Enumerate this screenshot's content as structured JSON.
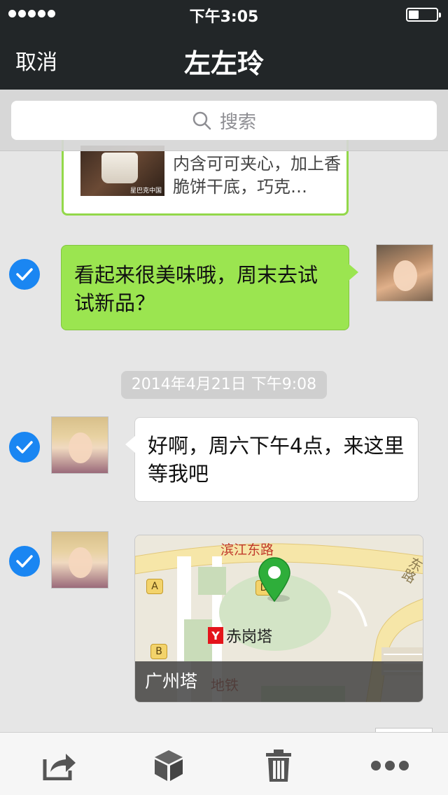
{
  "status_bar": {
    "time": "下午3:05"
  },
  "nav": {
    "cancel_label": "取消",
    "title": "左左玲"
  },
  "search": {
    "placeholder": "搜索"
  },
  "messages": {
    "shared_card": {
      "description": "内含可可夹心，加上香脆饼干底，巧克…",
      "source": "星巴克中国",
      "selected": true
    },
    "my_message": {
      "text": "看起来很美味哦，周末去试试新品？",
      "selected": true
    },
    "timestamp": "2014年4月21日 下午9:08",
    "reply": {
      "text": "好啊，周六下午4点，来这里等我吧",
      "selected": true
    },
    "location": {
      "name": "广州塔",
      "map_labels": {
        "road": "滨江东路",
        "station": "赤岗塔",
        "metro": "地铁",
        "side_road": "东路"
      },
      "exit_markers": [
        "A",
        "B",
        "D"
      ],
      "selected": true
    }
  },
  "toolbar": {
    "icons": [
      "share-icon",
      "cube-icon",
      "trash-icon",
      "more-icon"
    ]
  },
  "colors": {
    "nav_bg": "#222628",
    "sent_bubble": "#9be550",
    "check_blue": "#1a86f2",
    "chat_bg": "#e6e6e6"
  }
}
